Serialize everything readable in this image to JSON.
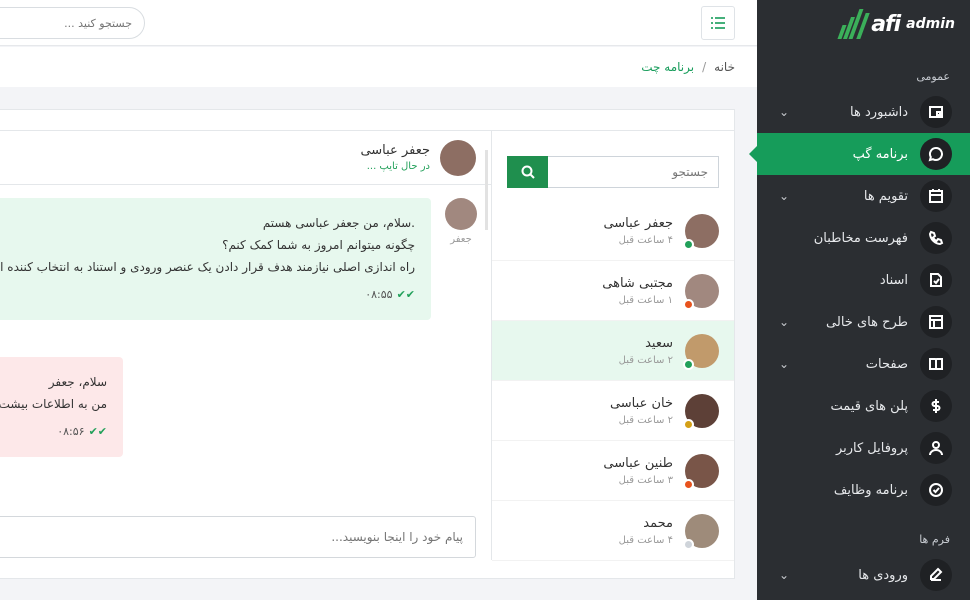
{
  "brand": {
    "name": "afi",
    "suffix": "admin",
    "accent": "#169c5a"
  },
  "topbar": {
    "search_placeholder": "جستجو کنید ..."
  },
  "breadcrumb": {
    "home": "خانه",
    "separator": "/",
    "current": "برنامه چت"
  },
  "sidebar": {
    "section_general": "عمومی",
    "items": [
      {
        "label": "داشبورد ها",
        "icon": "dashboard-icon",
        "has_children": true
      },
      {
        "label": "برنامه گپ",
        "icon": "chat-icon",
        "active": true
      },
      {
        "label": "تقویم ها",
        "icon": "calendar-icon",
        "has_children": true
      },
      {
        "label": "فهرست مخاطبان",
        "icon": "phone-icon"
      },
      {
        "label": "اسناد",
        "icon": "document-icon"
      },
      {
        "label": "طرح های خالی",
        "icon": "layout-icon",
        "has_children": true
      },
      {
        "label": "صفحات",
        "icon": "book-icon",
        "has_children": true
      },
      {
        "label": "پلن های قیمت",
        "icon": "dollar-icon"
      },
      {
        "label": "پروفایل کاربر",
        "icon": "user-icon"
      },
      {
        "label": "برنامه وظایف",
        "icon": "check-circle-icon"
      }
    ],
    "section_forms": "فرم ها",
    "forms_items": [
      {
        "label": "ورودی ها",
        "icon": "edit-icon",
        "has_children": true
      }
    ]
  },
  "contacts": {
    "search_placeholder": "جستجو",
    "list": [
      {
        "name": "جعفر عباسی",
        "time": "۴ ساعت قبل",
        "status_color": "#22a05a",
        "avatar_color": "#8d6e63"
      },
      {
        "name": "مجتبی شاهی",
        "time": "۱ ساعت قبل",
        "status_color": "#e8531d",
        "avatar_color": "#a1887f"
      },
      {
        "name": "سعید",
        "time": "۲ ساعت قبل",
        "status_color": "#22a05a",
        "avatar_color": "#c19a6b",
        "selected": true
      },
      {
        "name": "خان عباسی",
        "time": "۲ ساعت قبل",
        "status_color": "#d4a017",
        "avatar_color": "#5d4037"
      },
      {
        "name": "طنین عباسی",
        "time": "۳ ساعت قبل",
        "status_color": "#e8531d",
        "avatar_color": "#795548"
      },
      {
        "name": "محمد",
        "time": "۴ ساعت قبل",
        "status_color": "#cfd4da",
        "avatar_color": "#9e8b7a"
      }
    ]
  },
  "chat": {
    "header_name": "جعفر عباسی",
    "header_status": "در حال تایپ ...",
    "messages": [
      {
        "sender_label": "جعفر",
        "line1": ".سلام، من جعفر عباسی هستم",
        "line2": "چگونه میتوانم امروز به شما کمک کنم؟",
        "line3": "راه اندازی اصلی نیازمند هدف قرار دادن یک عنصر ورودی و استناد به انتخاب کننده ا",
        "time": "۰۸:۵۵"
      },
      {
        "line1": "سلام، جعفر",
        "line2": "من به اطلاعات بیشت",
        "time": "۰۸:۵۶"
      }
    ],
    "input_placeholder": "پیام خود را اینجا بنویسید..."
  }
}
